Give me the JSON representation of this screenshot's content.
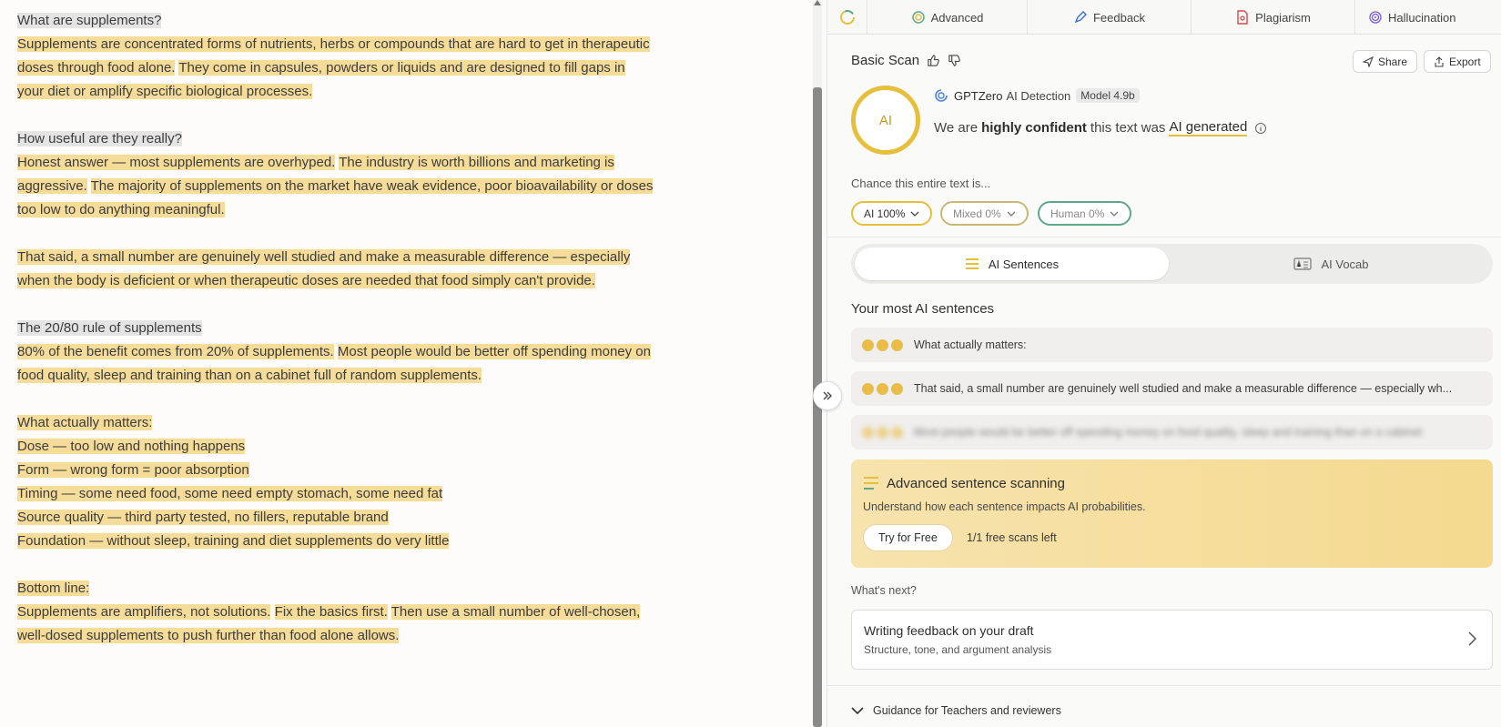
{
  "editor": {
    "p1_heading": "What are supplements?",
    "p1_s1": "Supplements are concentrated forms of nutrients, herbs or compounds that are hard to get in therapeutic doses through food alone.",
    "p1_s2": "They come in capsules, powders or liquids and are designed to fill gaps in your diet or amplify specific biological processes.",
    "p2_heading": "How useful are they really?",
    "p2_s1": "Honest answer — most supplements are overhyped.",
    "p2_s2": "The industry is worth billions and marketing is aggressive.",
    "p2_s3": "The majority of supplements on the market have weak evidence, poor bioavailability or doses too low to do anything meaningful.",
    "p3_s1": "That said, a small number are genuinely well studied and make a measurable difference — especially when the body is deficient or when therapeutic doses are needed that food simply can't provide.",
    "p4_heading": "The 20/80 rule of supplements",
    "p4_s1": "80% of the benefit comes from 20% of supplements.",
    "p4_s2": "Most people would be better off spending money on food quality, sleep and training than on a cabinet full of random supplements.",
    "p5_heading": "What actually matters:",
    "p5_items": [
      "Dose — too low and nothing happens",
      "Form — wrong form = poor absorption",
      "Timing — some need food, some need empty stomach, some need fat",
      "Source quality — third party tested, no fillers, reputable brand",
      "Foundation — without sleep, training and diet supplements do very little"
    ],
    "p6_heading": "Bottom line:",
    "p6_s1": "Supplements are amplifiers, not solutions.",
    "p6_s2": "Fix the basics first.",
    "p6_s3": "Then use a small number of well-chosen, well-dosed supplements to push further than food alone allows."
  },
  "tabs": {
    "advanced": "Advanced",
    "feedback": "Feedback",
    "plagiarism": "Plagiarism",
    "hallucination": "Hallucination"
  },
  "scan": {
    "title": "Basic Scan",
    "share": "Share",
    "export": "Export",
    "ring_label": "AI",
    "brand": "GPTZero",
    "detection": "AI Detection",
    "model": "Model 4.9b",
    "conf_pre": "We are",
    "conf_bold": "highly confident",
    "conf_mid": "this text was",
    "conf_result": "AI generated",
    "chance": "Chance this entire text is...",
    "pill_ai": "AI 100%",
    "pill_mixed": "Mixed 0%",
    "pill_human": "Human 0%",
    "ai_percent": 100,
    "mixed_percent": 0,
    "human_percent": 0
  },
  "colors": {
    "ai": "#e7bf3d",
    "mixed": "#c9b876",
    "human": "#5ea889",
    "highlight": "#f5dc99"
  },
  "segment": {
    "sentences": "AI Sentences",
    "vocab": "AI Vocab"
  },
  "most": {
    "title": "Your most AI sentences",
    "s1": "What actually matters:",
    "s2": "That said, a small number are genuinely well studied and make a measurable difference — especially wh...",
    "s3": "Most people would be better off spending money on food quality, sleep and training than on a cabinet"
  },
  "advanced": {
    "title": "Advanced sentence scanning",
    "subtitle": "Understand how each sentence impacts AI probabilities.",
    "try": "Try for Free",
    "free_left": "1/1 free scans left"
  },
  "next": {
    "label": "What's next?",
    "title": "Writing feedback on your draft",
    "sub": "Structure, tone, and argument analysis"
  },
  "guidance": "Guidance for Teachers and reviewers"
}
